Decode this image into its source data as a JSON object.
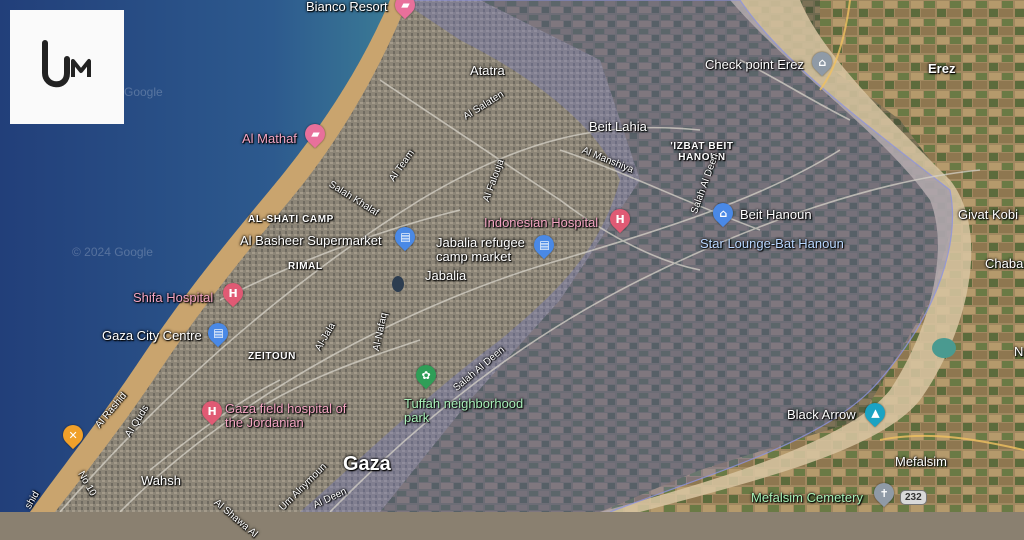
{
  "map": {
    "logo_icon": "um-logo-icon",
    "water_color": "#2b4f8e",
    "land_color": "#8a806f",
    "beach_color": "#c9a46e",
    "highlight_color": "#6a72c8",
    "watermarks": [
      "Google",
      "© 2024 Google"
    ],
    "labels": {
      "bianco_resort": "Bianco Resort",
      "atatra": "Atatra",
      "al_salaten": "Al Salaten",
      "al_mathaf": "Al Mathaf",
      "al_team": "Al Team",
      "salah_khalaf": "Salah Khalaf",
      "al_shati_camp": "AL-SHATI CAMP",
      "al_basheer_supermarket": "Al Basheer Supermarket",
      "jabalia_refugee_camp_market": "Jabalia refugee camp market",
      "indonesian_hospital": "Indonesian Hospital",
      "al_falouja": "Al Falouja",
      "beit_lahia": "Beit Lahia",
      "al_manshiya": "Al Manshiya",
      "izbat_beit_hanoun": "'IZBAT BEIT HANOUN",
      "check_point_erez": "Check point Erez",
      "erez": "Erez",
      "salah_al_deen_n": "Salah Al Deen",
      "beit_hanoun": "Beit Hanoun",
      "star_lounge": "Star Lounge-Bat Hanoun",
      "givat_kobi": "Givat Kobi",
      "chaba": "Chaba",
      "rimal": "RIMAL",
      "jabalia": "Jabalia",
      "shifa_hospital": "Shifa Hospital",
      "al_jala": "Al-Jala",
      "al_nafaq": "Al-Nafaq",
      "gaza_city_centre": "Gaza City Centre",
      "zeitoun": "ZEITOUN",
      "salah_al_deen_s": "Salah Al Deen",
      "tuffah_park": "Tuffah neighborhood park",
      "al_rashid": "Al Rashid",
      "al_quds": "Al Quds",
      "gaza_field_hospital": "Gaza field hospital of the Jordanian",
      "gaza": "Gaza",
      "black_arrow": "Black Arrow",
      "mefalsim": "Mefalsim",
      "mefalsim_cemetery": "Mefalsim Cemetery",
      "route_232": "232",
      "no_10": "No 10",
      "wahsh": "Wahsh",
      "al_shawa": "Al Shawa Al",
      "um_alnymoun": "Um Alnymoun",
      "al_deen_bottom": "Al Deen",
      "n_edge": "N",
      "shid": "shid"
    }
  }
}
